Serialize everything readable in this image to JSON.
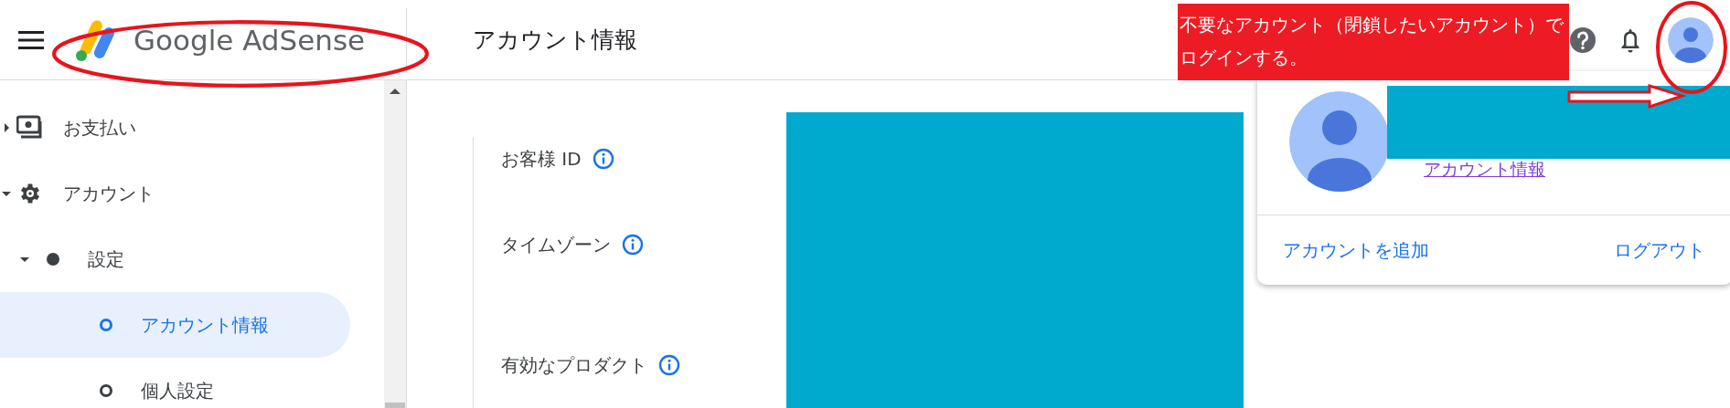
{
  "header": {
    "brand": "Google AdSense",
    "page_title": "アカウント情報"
  },
  "sidebar": {
    "items": [
      {
        "label": "お支払い",
        "expanded": false,
        "selected": false
      },
      {
        "label": "アカウント",
        "expanded": true,
        "selected": false,
        "children": [
          {
            "label": "設定",
            "expanded": true,
            "selected": false,
            "children": [
              {
                "label": "アカウント情報",
                "selected": true
              },
              {
                "label": "個人設定",
                "selected": false
              }
            ]
          }
        ]
      }
    ]
  },
  "fields": [
    {
      "label": "お客様 ID"
    },
    {
      "label": "タイムゾーン"
    },
    {
      "label": "有効なプロダクト"
    }
  ],
  "account_popup": {
    "link": "アカウント情報",
    "actions": [
      "アカウントを追加",
      "ログアウト"
    ]
  },
  "annotation": {
    "lines": [
      "不要なアカウント（閉鎖したいアカウント）で",
      "ログインする。"
    ]
  }
}
